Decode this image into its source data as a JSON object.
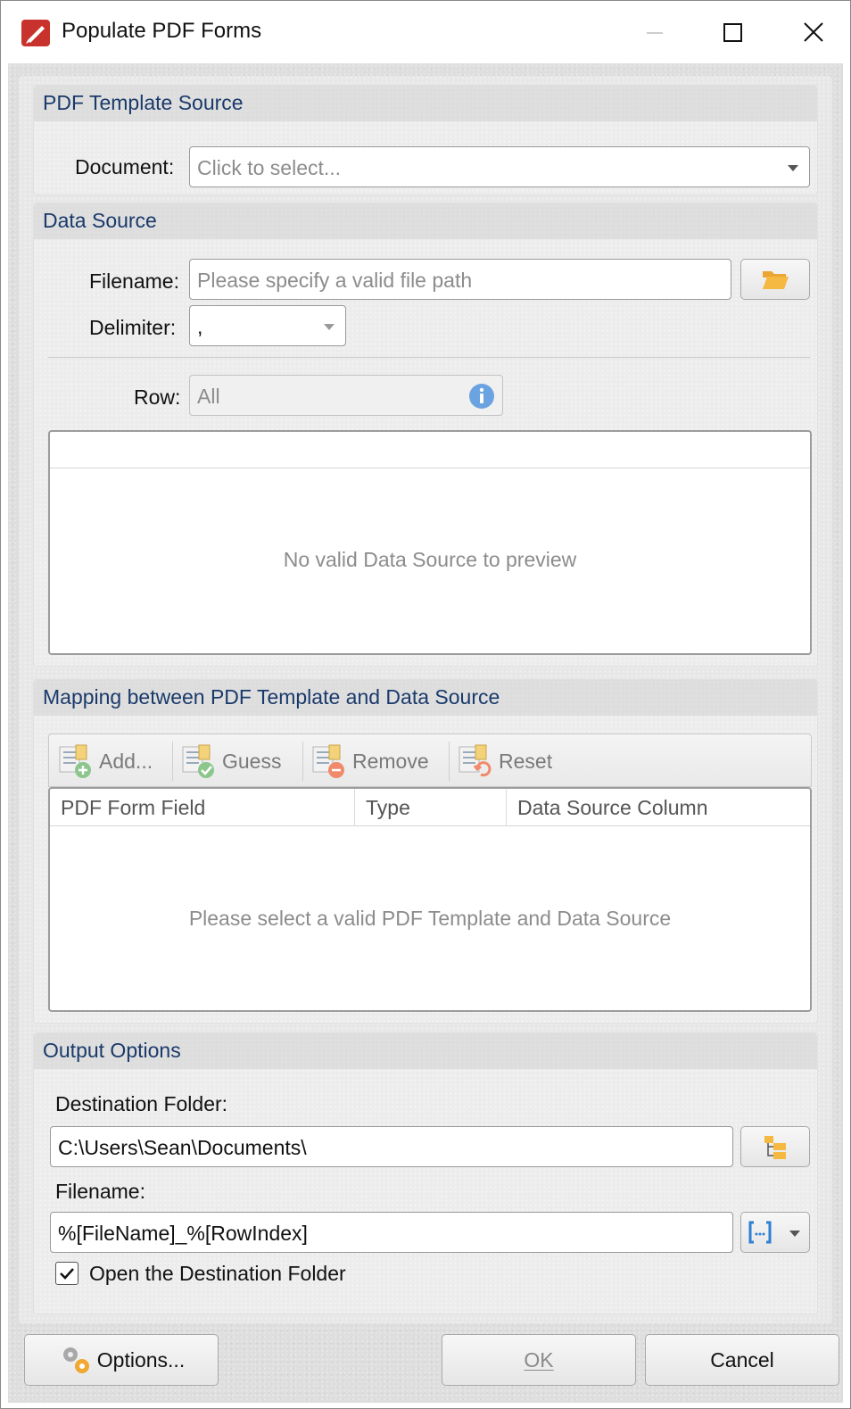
{
  "window": {
    "title": "Populate PDF Forms"
  },
  "template_source": {
    "title": "PDF Template Source",
    "document_label": "Document:",
    "document_placeholder": "Click to select..."
  },
  "data_source": {
    "title": "Data Source",
    "filename_label": "Filename:",
    "filename_placeholder": "Please specify a valid file path",
    "delimiter_label": "Delimiter:",
    "delimiter_value": ",",
    "row_label": "Row:",
    "row_value": "All",
    "preview_empty": "No valid Data Source to preview"
  },
  "mapping": {
    "title": "Mapping between PDF Template and Data Source",
    "toolbar": {
      "add": "Add...",
      "guess": "Guess",
      "remove": "Remove",
      "reset": "Reset"
    },
    "columns": [
      "PDF Form Field",
      "Type",
      "Data Source Column"
    ],
    "empty_message": "Please select a valid PDF Template and Data Source"
  },
  "output": {
    "title": "Output Options",
    "destination_label": "Destination Folder:",
    "destination_value": "C:\\Users\\Sean\\Documents\\",
    "filename_label": "Filename:",
    "filename_value": "%[FileName]_%[RowIndex]",
    "open_folder_label": "Open the Destination Folder",
    "open_folder_checked": true
  },
  "footer": {
    "options": "Options...",
    "ok": "OK",
    "cancel": "Cancel"
  },
  "colors": {
    "accent_icon_folder": "#f5b942",
    "info_icon": "#6aa3e0",
    "app_icon_red": "#c8322c"
  },
  "icons": [
    "app-logo-icon",
    "minimize-icon",
    "maximize-icon",
    "close-icon",
    "folder-open-icon",
    "info-icon",
    "add-mapping-icon",
    "guess-mapping-icon",
    "remove-mapping-icon",
    "reset-mapping-icon",
    "browse-folder-icon",
    "macro-icon",
    "gear-icon",
    "checkmark-icon"
  ]
}
